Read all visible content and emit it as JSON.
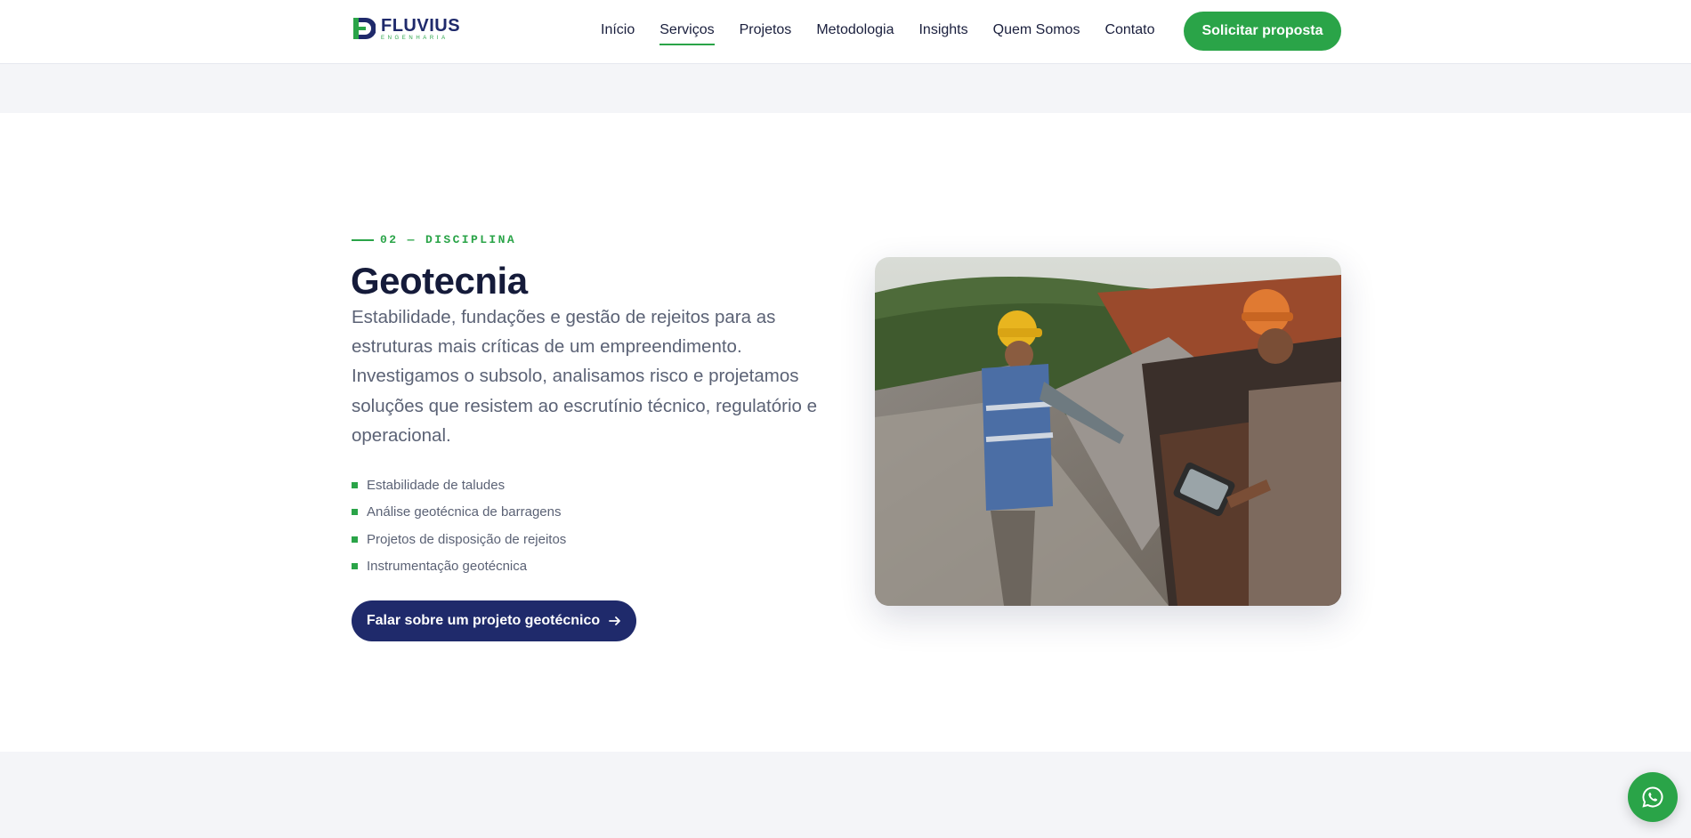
{
  "brand": {
    "name": "FLUVIUS",
    "sub": "ENGENHARIA",
    "primary_color": "#1f2a6b",
    "accent_color": "#2aa448"
  },
  "nav": {
    "items": [
      {
        "label": "Início",
        "active": false
      },
      {
        "label": "Serviços",
        "active": true
      },
      {
        "label": "Projetos",
        "active": false
      },
      {
        "label": "Metodologia",
        "active": false
      },
      {
        "label": "Insights",
        "active": false
      },
      {
        "label": "Quem Somos",
        "active": false
      },
      {
        "label": "Contato",
        "active": false
      }
    ],
    "cta_label": "Solicitar proposta"
  },
  "section": {
    "eyebrow": "02 — DISCIPLINA",
    "title": "Geotecnia",
    "description": "Estabilidade, fundações e gestão de rejeitos para as estruturas mais críticas de um empreendimento. Investigamos o subsolo, analisamos risco e projetamos soluções que resistem ao escrutínio técnico, regulatório e operacional.",
    "features": [
      "Estabilidade de taludes",
      "Análise geotécnica de barragens",
      "Projetos de disposição de rejeitos",
      "Instrumentação geotécnica"
    ],
    "cta_label": "Falar sobre um projeto geotécnico",
    "cta_icon": "arrow-right-icon",
    "photo_icon": "geotechnical-engineers-photo"
  },
  "floating": {
    "icon": "whatsapp-icon"
  }
}
